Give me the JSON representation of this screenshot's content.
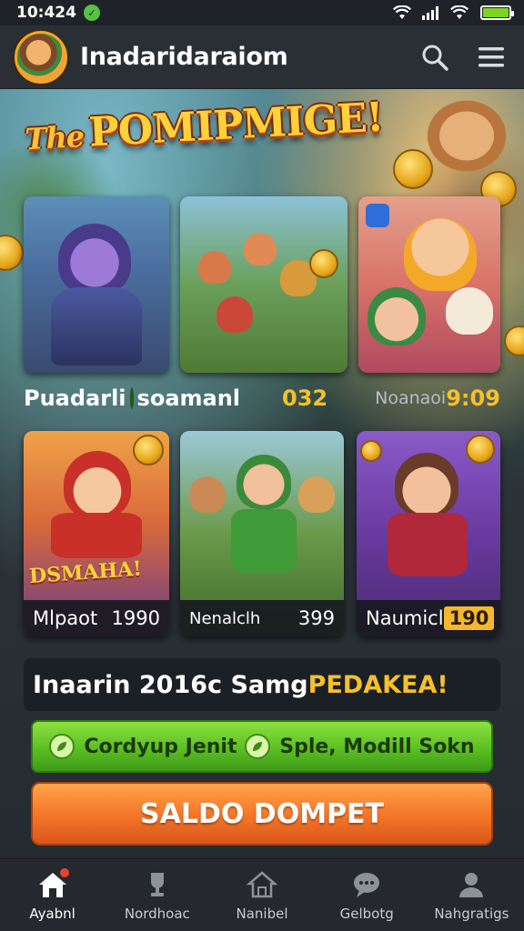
{
  "status_bar": {
    "time": "10:424"
  },
  "header": {
    "title": "Inadaridaraiom",
    "search_icon": "search-icon",
    "menu_icon": "hamburger-menu-icon"
  },
  "banner": {
    "prefix": "The",
    "title": "POMIPMIGE!"
  },
  "row1": {
    "left_label": "Puadarli",
    "left_label_2": "soamanl",
    "left_value": "032",
    "right_label": "Noanaoi",
    "right_value": "9:09"
  },
  "row2_cards": [
    {
      "label": "Mlpaot",
      "value": "1990",
      "art_text": "DSMAHA!"
    },
    {
      "label": "Nenalclh",
      "value": "399"
    },
    {
      "label": "Naumicl",
      "value": "190"
    }
  ],
  "promo": {
    "text": "Inaarin 2016c Samg ",
    "highlight": "PEDAKEA!"
  },
  "green_button": {
    "left_label": "Cordyup Jenit",
    "right_label": "Sple, Modill Sokn"
  },
  "orange_button": {
    "label": "SALDO DOMPET"
  },
  "bottom_nav": [
    {
      "label": "Ayabnl",
      "icon": "home-icon",
      "active": true
    },
    {
      "label": "Nordhoac",
      "icon": "trophy-icon",
      "active": false
    },
    {
      "label": "Nanibel",
      "icon": "house-outline-icon",
      "active": false
    },
    {
      "label": "Gelbotg",
      "icon": "chat-bubble-icon",
      "active": false
    },
    {
      "label": "Nahgratigs",
      "icon": "profile-icon",
      "active": false
    }
  ],
  "colors": {
    "accent_yellow": "#f5c02a",
    "green_button": "#5bbf22",
    "orange_button": "#f6782a",
    "background": "#23272e"
  }
}
